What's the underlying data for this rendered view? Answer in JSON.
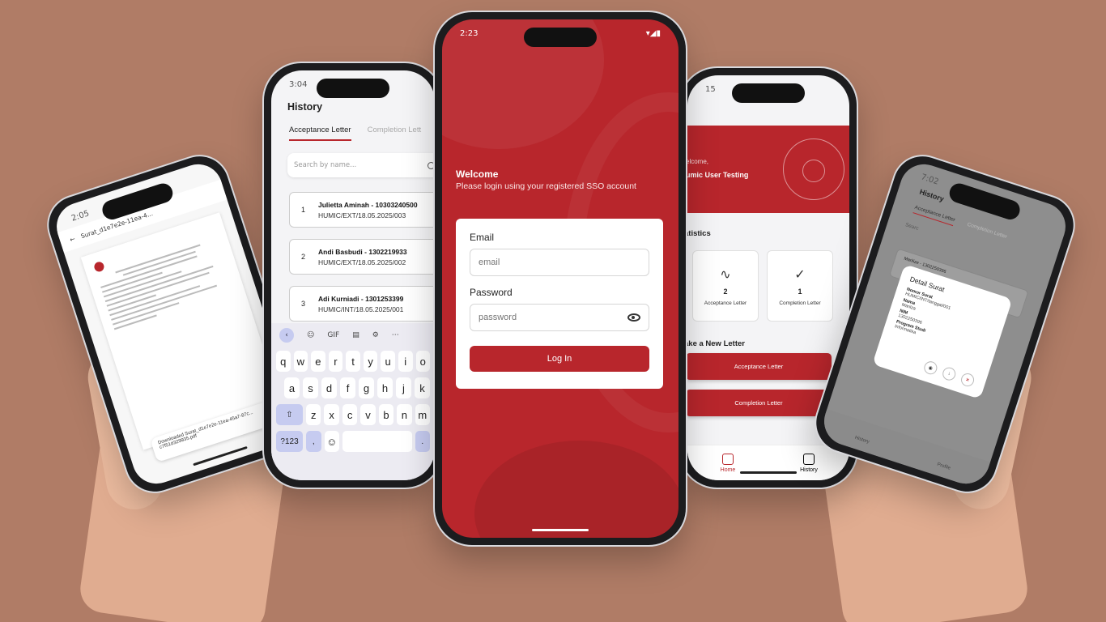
{
  "colors": {
    "background": "#b07c66",
    "brand_red": "#b8262c",
    "white": "#ffffff"
  },
  "login": {
    "status_time": "2:23",
    "welcome_title": "Welcome",
    "welcome_subtitle": "Please login using your registered SSO account",
    "email_label": "Email",
    "email_placeholder": "email",
    "password_label": "Password",
    "password_placeholder": "password",
    "login_button": "Log In",
    "icons": [
      "eye-icon"
    ]
  },
  "history": {
    "status_time": "3:04",
    "title": "History",
    "tabs": [
      "Acceptance Letter",
      "Completion Lett"
    ],
    "search_placeholder": "Search by name...",
    "items": [
      {
        "num": "1",
        "name": "Julietta Aminah - 10303240500",
        "code": "HUMIC/EXT/18.05.2025/003"
      },
      {
        "num": "2",
        "name": "Andi Basbudi - 1302219933",
        "code": "HUMIC/EXT/18.05.2025/002"
      },
      {
        "num": "3",
        "name": "Adi Kurniadi - 1301253399",
        "code": "HUMIC/INT/18.05.2025/001"
      }
    ],
    "keyboard": {
      "tools": [
        "GIF"
      ],
      "row1": [
        "q",
        "w",
        "e",
        "r",
        "t",
        "y",
        "u",
        "i",
        "o"
      ],
      "row2": [
        "a",
        "s",
        "d",
        "f",
        "g",
        "h",
        "j",
        "k"
      ],
      "row3": [
        "z",
        "x",
        "c",
        "v",
        "b",
        "n",
        "m"
      ],
      "numbers_key": "?123",
      "comma_key": ",",
      "period_key": "."
    }
  },
  "home": {
    "status_time": "15",
    "welcome": "elcome,",
    "user_name": "umic User Testing",
    "statistics_title": "atistics",
    "stats": [
      {
        "value": "2",
        "label": "Acceptance Letter"
      },
      {
        "value": "1",
        "label": "Completion Letter"
      }
    ],
    "make_title": "ake a New Letter",
    "buttons": [
      "Acceptance Letter",
      "Completion Letter"
    ],
    "nav": [
      "Home",
      "History"
    ]
  },
  "pdf": {
    "status_time": "2:05",
    "file_title": "Surat_d1e7e2e-11ea-4...",
    "toast": "Downloaded Surat_d1e7e2e-11ea-45a7-87c... c7f51d329935.pdf"
  },
  "detail": {
    "status_time": "7:02",
    "title": "History",
    "tabs": [
      "Acceptance Letter",
      "Completion Letter"
    ],
    "search_placeholder": "Searc",
    "row_text": "Marilize - 1302250396",
    "modal_title": "Detail Surat",
    "fields": [
      {
        "key": "Nomor Surat",
        "value": "HUMIC/INT/tanggal/001"
      },
      {
        "key": "Nama",
        "value": "Marilza"
      },
      {
        "key": "NIM",
        "value": "1302250396"
      },
      {
        "key": "Program Studi",
        "value": "Informatika"
      }
    ],
    "nav": [
      "History",
      "Profile"
    ]
  }
}
